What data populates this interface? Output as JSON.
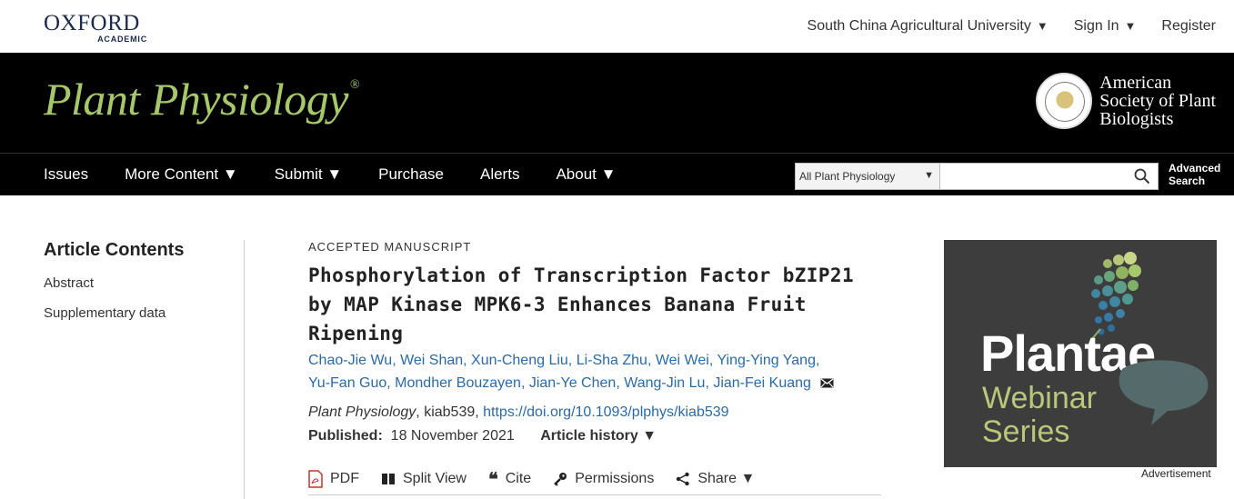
{
  "header": {
    "brand_top": "OXFORD",
    "brand_bottom": "ACADEMIC",
    "institution": "South China Agricultural University",
    "sign_in": "Sign In",
    "register": "Register"
  },
  "banner": {
    "journal_title": "Plant Physiology",
    "reg_mark": "®",
    "society_line1": "American",
    "society_line2": "Society of Plant",
    "society_line3": "Biologists"
  },
  "nav": {
    "items": [
      "Issues",
      "More Content ▼",
      "Submit ▼",
      "Purchase",
      "Alerts",
      "About ▼"
    ],
    "search_scope": "All Plant Physiology",
    "search_value": "",
    "advanced_line1": "Advanced",
    "advanced_line2": "Search"
  },
  "sidebar": {
    "heading": "Article Contents",
    "links": [
      "Abstract",
      "Supplementary data"
    ]
  },
  "article": {
    "label": "ACCEPTED MANUSCRIPT",
    "title": "Phosphorylation of Transcription Factor bZIP21 by MAP Kinase MPK6-3 Enhances Banana Fruit Ripening",
    "authors": [
      "Chao-Jie Wu",
      "Wei Shan",
      "Xun-Cheng Liu",
      "Li-Sha Zhu",
      "Wei Wei",
      "Ying-Ying Yang",
      "Yu-Fan Guo",
      "Mondher Bouzayen",
      "Jian-Ye Chen",
      "Wang-Jin Lu",
      "Jian-Fei Kuang"
    ],
    "journal": "Plant Physiology",
    "article_id": ", kiab539, ",
    "doi": "https://doi.org/10.1093/plphys/kiab539",
    "published_label": "Published:",
    "published_date": "18 November 2021",
    "history_label": "Article history ▼"
  },
  "tools": {
    "pdf": "PDF",
    "split_view": "Split View",
    "cite": "Cite",
    "permissions": "Permissions",
    "share": "Share ▼"
  },
  "ad": {
    "brand": "Plantae",
    "line1": "Webinar",
    "line2": "Series",
    "label": "Advertisement"
  },
  "colors": {
    "banner_bg": "#000000",
    "journal_green": "#a7c76b",
    "link_blue": "#2c6aa6",
    "pdf_red": "#c0392b",
    "ad_bg": "#3d3d3d"
  }
}
